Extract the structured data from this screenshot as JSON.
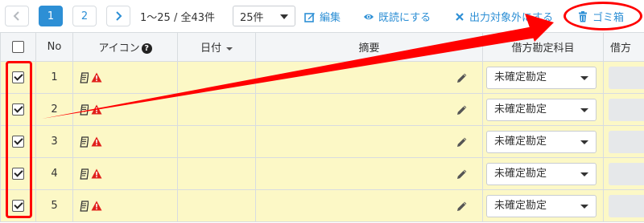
{
  "pagination": {
    "prev": "‹",
    "pages": [
      "1",
      "2"
    ],
    "next": "›",
    "range_text": "1〜25 / 全43件",
    "per_page": "25件"
  },
  "toolbar": {
    "edit": "編集",
    "mark_read": "既読にする",
    "exclude": "出力対象外にする",
    "trash": "ゴミ箱"
  },
  "table": {
    "headers": {
      "no": "No",
      "icon": "アイコン",
      "date": "日付",
      "summary": "摘要",
      "debit_account": "借方勘定科目",
      "credit_partial": "借方"
    },
    "rows": [
      {
        "no": "1",
        "account": "未確定勘定",
        "checked": true
      },
      {
        "no": "2",
        "account": "未確定勘定",
        "checked": true
      },
      {
        "no": "3",
        "account": "未確定勘定",
        "checked": true
      },
      {
        "no": "4",
        "account": "未確定勘定",
        "checked": true
      },
      {
        "no": "5",
        "account": "未確定勘定",
        "checked": true
      }
    ]
  },
  "colors": {
    "accent": "#2d8fd5",
    "row_bg": "#fcf8c6",
    "annotation": "#ff0000",
    "warning": "#e0211b"
  }
}
